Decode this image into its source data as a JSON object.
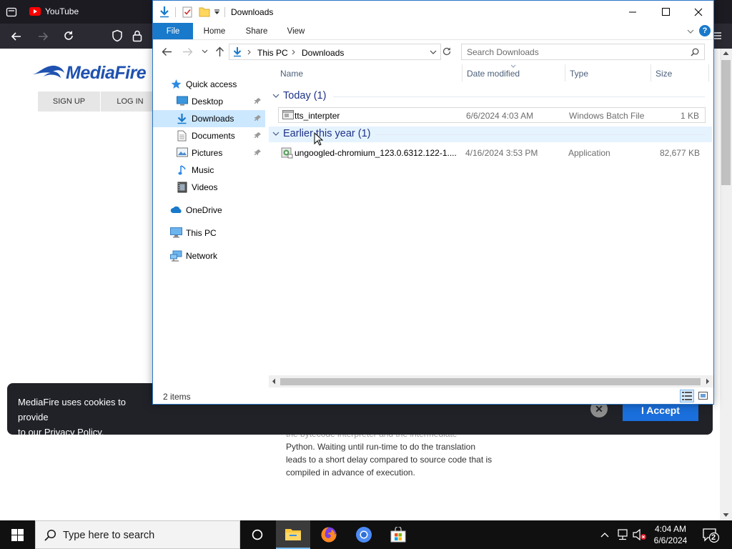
{
  "browser": {
    "tab_title": "YouTube",
    "page": {
      "logo_text": "MediaFire",
      "signup_label": "SIGN UP",
      "login_label": "LOG IN",
      "paragraph_faint": "the bytecode interpreter and the intermediate",
      "paragraph_line1": "Python. Waiting until run-time to do the translation",
      "paragraph_line2": "leads to a short delay compared to source code that is",
      "paragraph_line3": "compiled in advance of execution."
    },
    "cookie_banner": {
      "text": "MediaFire uses cookies to provide",
      "text2": "to our Privacy Policy.",
      "accept_label": "I Accept",
      "close_glyph": "✕"
    }
  },
  "explorer": {
    "title": "Downloads",
    "ribbon_tabs": [
      "File",
      "Home",
      "Share",
      "View"
    ],
    "help_glyph": "?",
    "breadcrumb": [
      "This PC",
      "Downloads"
    ],
    "search_placeholder": "Search Downloads",
    "nav": {
      "quick_access": "Quick access",
      "desktop": "Desktop",
      "downloads": "Downloads",
      "documents": "Documents",
      "pictures": "Pictures",
      "music": "Music",
      "videos": "Videos",
      "onedrive": "OneDrive",
      "this_pc": "This PC",
      "network": "Network"
    },
    "columns": [
      "Name",
      "Date modified",
      "Type",
      "Size"
    ],
    "groups": [
      {
        "label": "Today (1)",
        "files": [
          {
            "name": "tts_interpter",
            "date": "6/6/2024 4:03 AM",
            "type": "Windows Batch File",
            "size": "1 KB",
            "icon": "batch-file-icon"
          }
        ]
      },
      {
        "label": "Earlier this year (1)",
        "files": [
          {
            "name": "ungoogled-chromium_123.0.6312.122-1....",
            "date": "4/16/2024 3:53 PM",
            "type": "Application",
            "size": "82,677 KB",
            "icon": "application-icon"
          }
        ]
      }
    ],
    "status": "2 items"
  },
  "taskbar": {
    "search_placeholder": "Type here to search",
    "time": "4:04 AM",
    "date": "6/6/2024",
    "notification_count": "2"
  },
  "colors": {
    "accent": "#1979ca",
    "selection": "#cce8ff",
    "group_header": "#1e3287",
    "cookie_accept": "#1a6fdc",
    "mediafire_blue": "#1f52b0"
  }
}
